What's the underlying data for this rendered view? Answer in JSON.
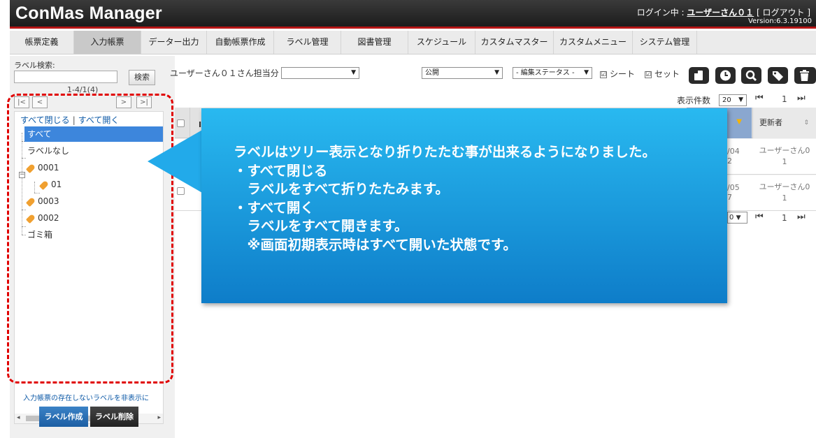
{
  "header": {
    "app_title": "ConMas Manager",
    "login_prefix": "ログイン中 : ",
    "user_name": "ユーザーさん０１",
    "logout_label": " [ ログアウト ]",
    "version": "Version:6.3.19100"
  },
  "nav": {
    "tabs": [
      "帳票定義",
      "入力帳票",
      "データー出力",
      "自動帳票作成",
      "ラベル管理",
      "図書管理",
      "スケジュール",
      "カスタムマスター",
      "カスタムメニュー",
      "システム管理"
    ],
    "active_index": 1
  },
  "sidebar": {
    "search_label": "ラベル検索:",
    "search_value": "",
    "search_button": "検索",
    "pager_text": "1-4/1(4)",
    "pager_first": "|<",
    "pager_prev": "<",
    "pager_next": ">",
    "pager_last": ">|",
    "collapse_all": "すべて閉じる",
    "link_separator": "|",
    "expand_all": "すべて開く",
    "tree": {
      "all": "すべて",
      "no_label": "ラベルなし",
      "l0001": "0001",
      "l01": "01",
      "l0003": "0003",
      "l0002": "0002",
      "trash": "ゴミ箱"
    },
    "hide_empty_link": "入力帳票の存在しないラベルを非表示に",
    "create_button": "ラベル作成",
    "delete_button": "ラベル削除"
  },
  "filters": {
    "assignee_label": "ユーザーさん０１さん担当分",
    "assignee_value": "",
    "public_value": "公開",
    "status_value": "- 編集ステータス -",
    "sheet_label": "シート",
    "set_label": "セット",
    "sheet_checked": true,
    "set_checked": true,
    "checkmark": "☑"
  },
  "toolbar_icons": [
    "document-icon",
    "clock-icon",
    "search-icon",
    "tag-icon",
    "trash-icon"
  ],
  "grid": {
    "page_size_label": "表示件数",
    "page_size_value": "20",
    "page_first_arrow": "⏮",
    "page_next_arrow": "⏭",
    "page_number": "1",
    "bottom_page_value": "0",
    "header_partial": "I",
    "updater_header": "更新者",
    "sort_arrow": "▼",
    "sort_both": "⇕",
    "rows": [
      {
        "date_a": "/04",
        "date_b": "2",
        "user_a": "ユーザーさん0",
        "user_b": "1"
      },
      {
        "date_a": "/05",
        "date_b": "7",
        "user_a": "ユーザーさん0",
        "user_b": "1"
      }
    ]
  },
  "callout": {
    "text": "ラベルはツリー表示となり折りたたむ事が出来るようになりました。\n・すべて閉じる\n　ラベルをすべて折りたたみます。\n・すべて開く\n　ラベルをすべて開きます。\n　※画面初期表示時はすべて開いた状態です。"
  },
  "colors": {
    "header_accent": "#b51515",
    "selected_item": "#3d86dc",
    "callout": "#1ea3e6",
    "annotation_frame": "#e00000",
    "create_button": "#2a70b5"
  }
}
